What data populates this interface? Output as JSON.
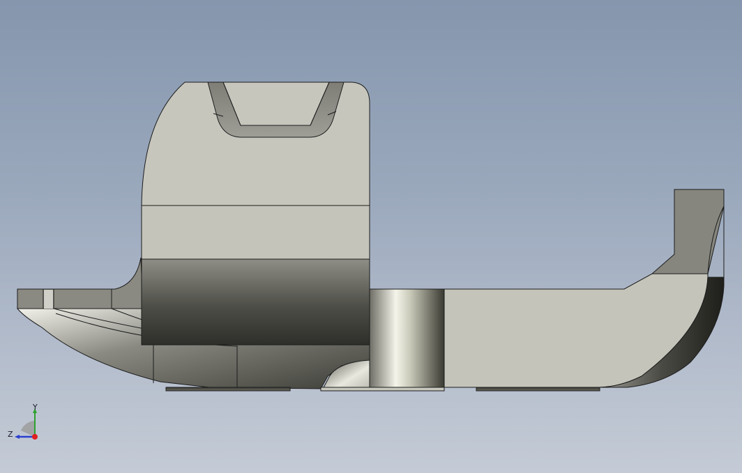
{
  "viewport": {
    "background_top": "#8596ad",
    "background_bottom": "#c4cbd6"
  },
  "model": {
    "face_color_light": "#c6c6bd",
    "face_color_mid": "#a8a89f",
    "face_color_dark": "#4a4a44",
    "edge_color": "#1c1c1c"
  },
  "triad": {
    "y_label": "Y",
    "z_label": "Z",
    "y_axis_color": "#2ea12e",
    "z_axis_color": "#2b3fd0",
    "x_axis_color": "#e02020"
  }
}
